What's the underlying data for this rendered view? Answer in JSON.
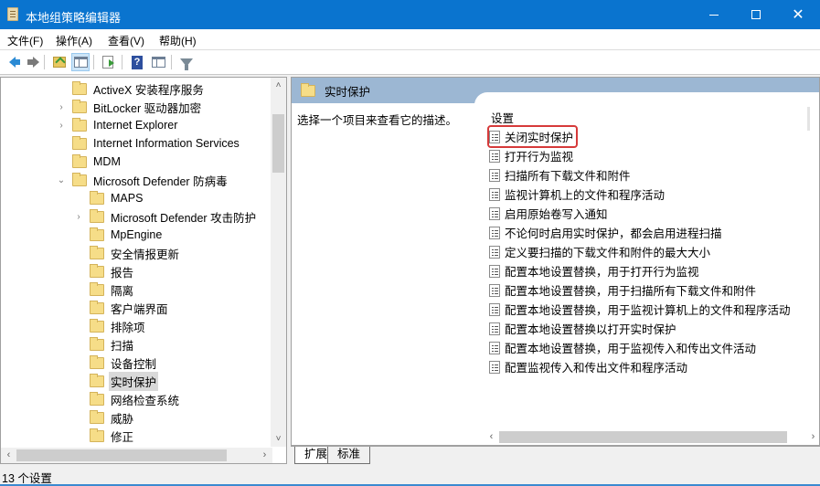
{
  "window": {
    "title": "本地组策略编辑器",
    "minimize_label": "minimize",
    "maximize_label": "maximize",
    "close_label": "close"
  },
  "menu": {
    "items": [
      {
        "label": "文件(F)"
      },
      {
        "label": "操作(A)"
      },
      {
        "label": "查看(V)"
      },
      {
        "label": "帮助(H)"
      }
    ]
  },
  "toolbar": {
    "icons": [
      "back-icon",
      "forward-icon",
      "folder-up-icon",
      "show-hide-tree-icon",
      "export-list-icon",
      "help-icon",
      "properties-pane-icon",
      "filter-icon"
    ]
  },
  "tree": {
    "items": [
      {
        "label": "ActiveX 安装程序服务",
        "level": 0,
        "expander": ""
      },
      {
        "label": "BitLocker 驱动器加密",
        "level": 0,
        "expander": "›"
      },
      {
        "label": "Internet Explorer",
        "level": 0,
        "expander": "›"
      },
      {
        "label": "Internet Information Services",
        "level": 0,
        "expander": ""
      },
      {
        "label": "MDM",
        "level": 0,
        "expander": ""
      },
      {
        "label": "Microsoft Defender 防病毒",
        "level": 0,
        "expander": "⌄"
      },
      {
        "label": "MAPS",
        "level": 1,
        "expander": ""
      },
      {
        "label": "Microsoft Defender 攻击防护",
        "level": 1,
        "expander": "›"
      },
      {
        "label": "MpEngine",
        "level": 1,
        "expander": ""
      },
      {
        "label": "安全情报更新",
        "level": 1,
        "expander": ""
      },
      {
        "label": "报告",
        "level": 1,
        "expander": ""
      },
      {
        "label": "隔离",
        "level": 1,
        "expander": ""
      },
      {
        "label": "客户端界面",
        "level": 1,
        "expander": ""
      },
      {
        "label": "排除项",
        "level": 1,
        "expander": ""
      },
      {
        "label": "扫描",
        "level": 1,
        "expander": ""
      },
      {
        "label": "设备控制",
        "level": 1,
        "expander": ""
      },
      {
        "label": "实时保护",
        "level": 1,
        "expander": "",
        "selected": true
      },
      {
        "label": "网络检查系统",
        "level": 1,
        "expander": ""
      },
      {
        "label": "威胁",
        "level": 1,
        "expander": ""
      },
      {
        "label": "修正",
        "level": 1,
        "expander": ""
      }
    ]
  },
  "right": {
    "header": "实时保护",
    "description": "选择一个项目来查看它的描述。",
    "settings_heading": "设置",
    "settings": [
      {
        "label": "关闭实时保护",
        "highlighted": true
      },
      {
        "label": "打开行为监视"
      },
      {
        "label": "扫描所有下载文件和附件"
      },
      {
        "label": "监视计算机上的文件和程序活动"
      },
      {
        "label": "启用原始卷写入通知"
      },
      {
        "label": "不论何时启用实时保护，都会启用进程扫描"
      },
      {
        "label": "定义要扫描的下载文件和附件的最大大小"
      },
      {
        "label": "配置本地设置替换，用于打开行为监视"
      },
      {
        "label": "配置本地设置替换，用于扫描所有下载文件和附件"
      },
      {
        "label": "配置本地设置替换，用于监视计算机上的文件和程序活动"
      },
      {
        "label": "配置本地设置替换以打开实时保护"
      },
      {
        "label": "配置本地设置替换，用于监视传入和传出文件活动"
      },
      {
        "label": "配置监视传入和传出文件和程序活动"
      }
    ],
    "highlight_color": "#d63a3a"
  },
  "tabs": [
    {
      "label": "扩展",
      "active": true
    },
    {
      "label": "标准",
      "active": false
    }
  ],
  "status": {
    "text": "13 个设置"
  },
  "colors": {
    "titlebar": "#0a74cf",
    "pane_header": "#9cb7d3"
  }
}
